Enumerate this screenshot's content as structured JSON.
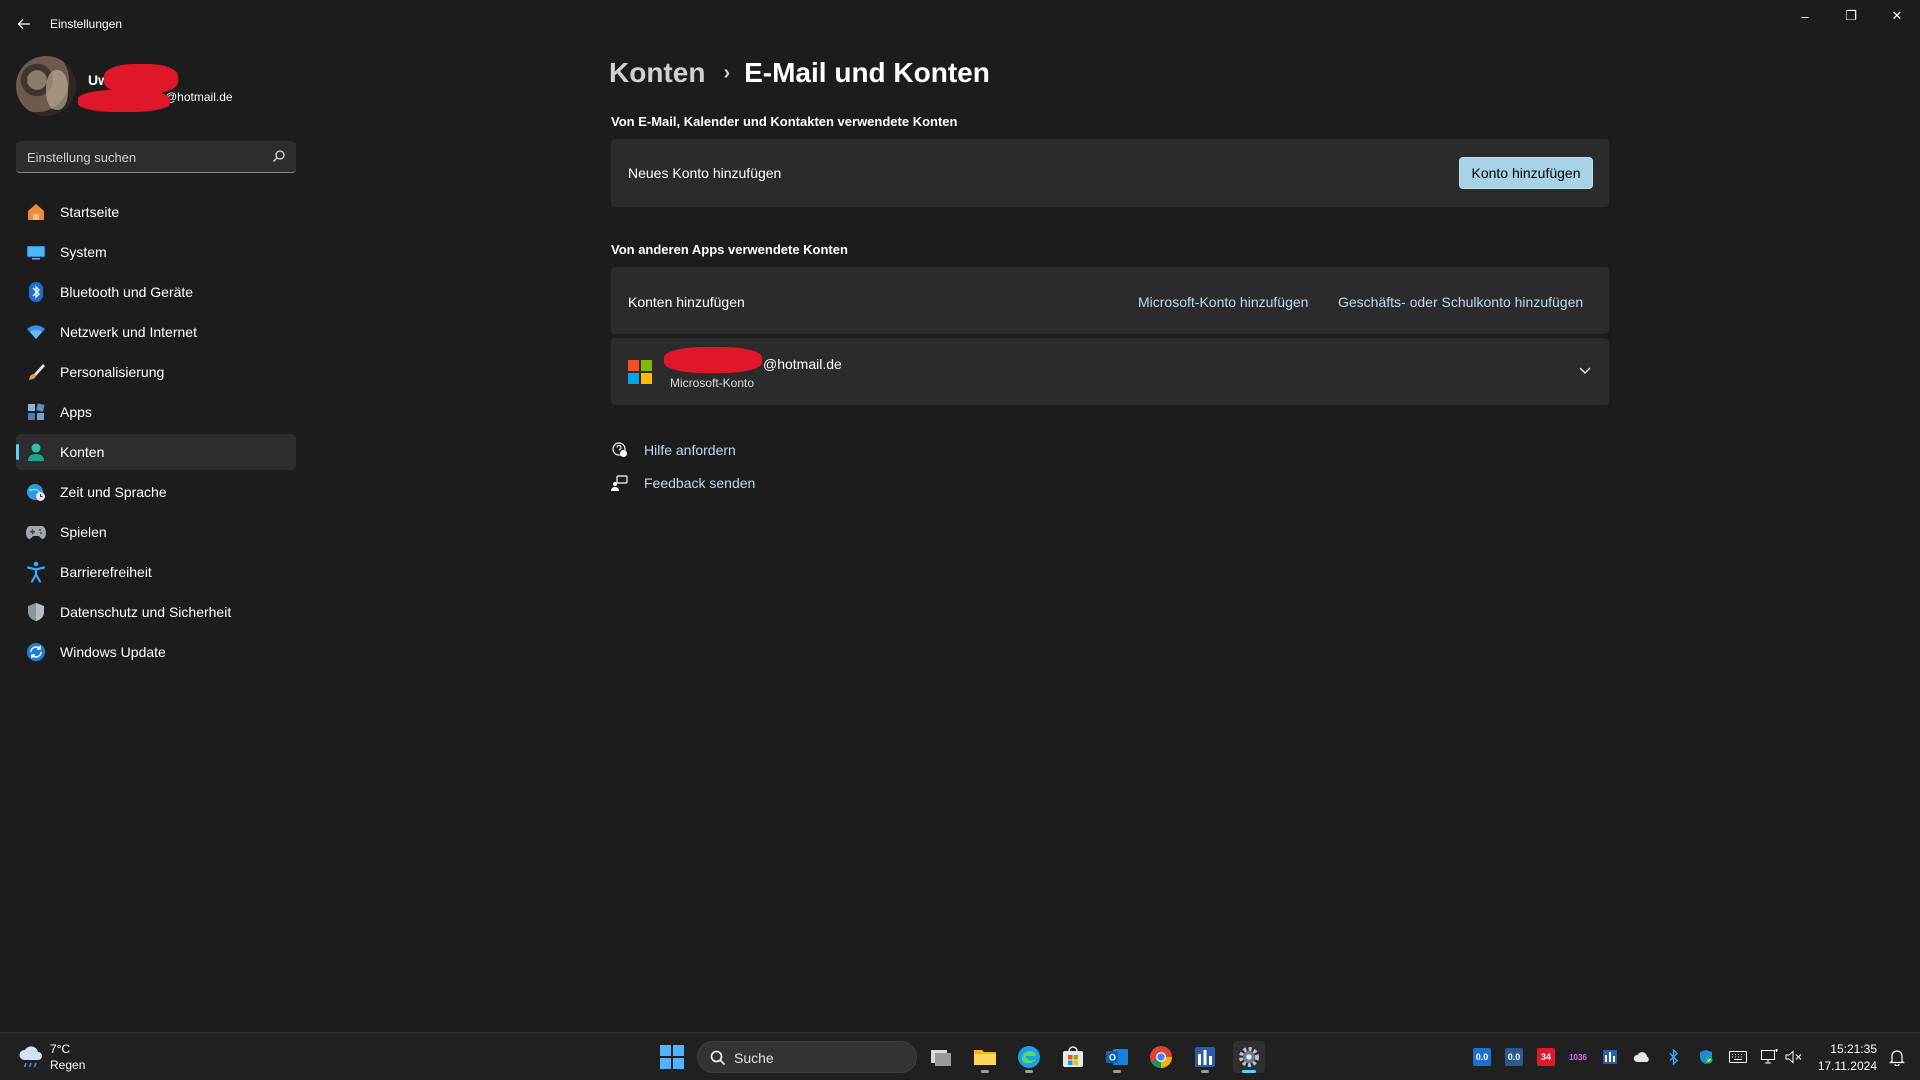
{
  "window": {
    "title": "Einstellungen",
    "back_icon": "arrow-left-icon",
    "controls": {
      "minimize": "–",
      "maximize": "❐",
      "close": "✕"
    }
  },
  "profile": {
    "name": "Uwe",
    "email": "@hotmail.de"
  },
  "search": {
    "placeholder": "Einstellung suchen"
  },
  "sidebar": {
    "items": [
      {
        "label": "Startseite",
        "icon": "home-icon"
      },
      {
        "label": "System",
        "icon": "monitor-icon"
      },
      {
        "label": "Bluetooth und Geräte",
        "icon": "bluetooth-icon"
      },
      {
        "label": "Netzwerk und Internet",
        "icon": "wifi-icon"
      },
      {
        "label": "Personalisierung",
        "icon": "brush-icon"
      },
      {
        "label": "Apps",
        "icon": "apps-icon"
      },
      {
        "label": "Konten",
        "icon": "person-icon",
        "active": true
      },
      {
        "label": "Zeit und Sprache",
        "icon": "globe-clock-icon"
      },
      {
        "label": "Spielen",
        "icon": "gamepad-icon"
      },
      {
        "label": "Barrierefreiheit",
        "icon": "accessibility-icon"
      },
      {
        "label": "Datenschutz und Sicherheit",
        "icon": "shield-icon"
      },
      {
        "label": "Windows Update",
        "icon": "update-icon"
      }
    ]
  },
  "breadcrumb": {
    "parent": "Konten",
    "separator": "›",
    "current": "E-Mail und Konten"
  },
  "section1": {
    "title": "Von E-Mail, Kalender und Kontakten verwendete Konten",
    "row_label": "Neues Konto hinzufügen",
    "button": "Konto hinzufügen"
  },
  "section2": {
    "title": "Von anderen Apps verwendete Konten",
    "row_label": "Konten hinzufügen",
    "link_ms": "Microsoft-Konto hinzufügen",
    "link_work": "Geschäfts- oder Schulkonto hinzufügen",
    "account": {
      "email": "@hotmail.de",
      "type": "Microsoft-Konto"
    }
  },
  "help": {
    "get_help": "Hilfe anfordern",
    "feedback": "Feedback senden"
  },
  "taskbar": {
    "weather_temp": "7°C",
    "weather_desc": "Regen",
    "search_label": "Suche",
    "tray_labels": [
      "0.0",
      "0.0",
      "34",
      "1036"
    ],
    "time": "15:21:35",
    "date": "17.11.2024"
  },
  "colors": {
    "background": "#1c1c1c",
    "card": "#2b2b2b",
    "accent": "#60cdff",
    "button": "#a8d3e6",
    "link": "#b9dcf0"
  }
}
